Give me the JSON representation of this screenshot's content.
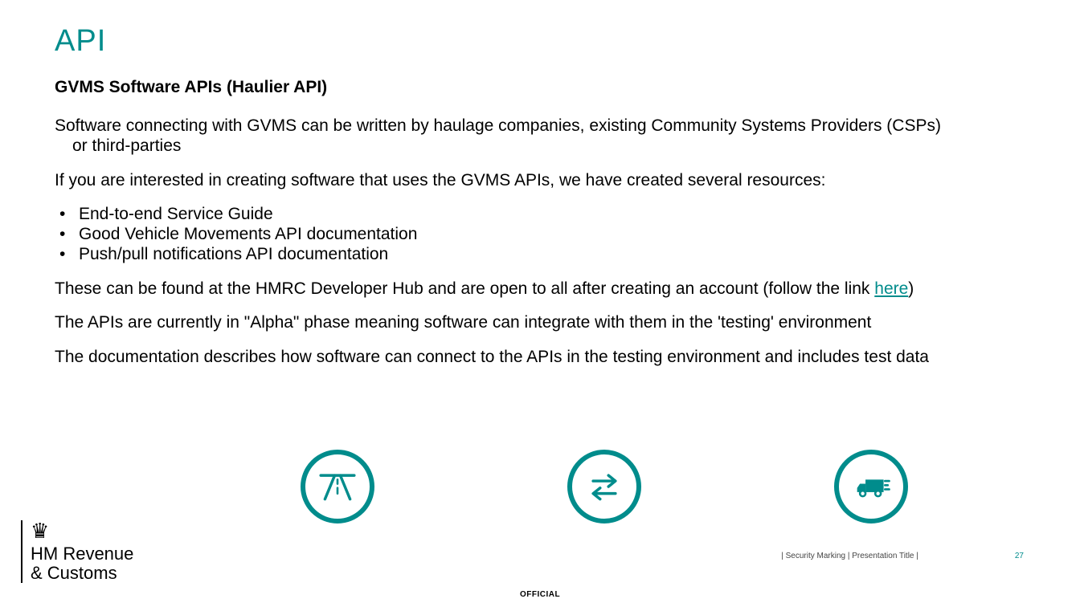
{
  "title": "API",
  "subtitle": "GVMS Software APIs (Haulier API)",
  "para1_a": "Software connecting with GVMS can be written by haulage companies, existing Community Systems Providers (CSPs)",
  "para1_b": "or third-parties",
  "para2": "If you are interested in creating software that uses the GVMS APIs, we have created several resources:",
  "bullets": [
    "End-to-end Service Guide",
    "Good Vehicle Movements API documentation",
    "Push/pull notifications API documentation"
  ],
  "para3_a": "These can be found at the HMRC Developer Hub and are open to all after creating an account (follow the link ",
  "link_text": "here",
  "para3_b": ")",
  "para4": "The APIs are currently in \"Alpha\" phase meaning software can integrate with them in the 'testing' environment",
  "para5": "The documentation describes how software can connect to the APIs in the testing environment and includes test data",
  "logo": {
    "line1": "HM Revenue",
    "line2": "& Customs"
  },
  "footer": {
    "meta": "|  Security Marking  |   Presentation Title  |",
    "page_number": "27",
    "classification": "OFFICIAL"
  },
  "icons": {
    "road": "road-icon",
    "arrows": "bidirectional-arrows-icon",
    "truck": "truck-icon"
  }
}
